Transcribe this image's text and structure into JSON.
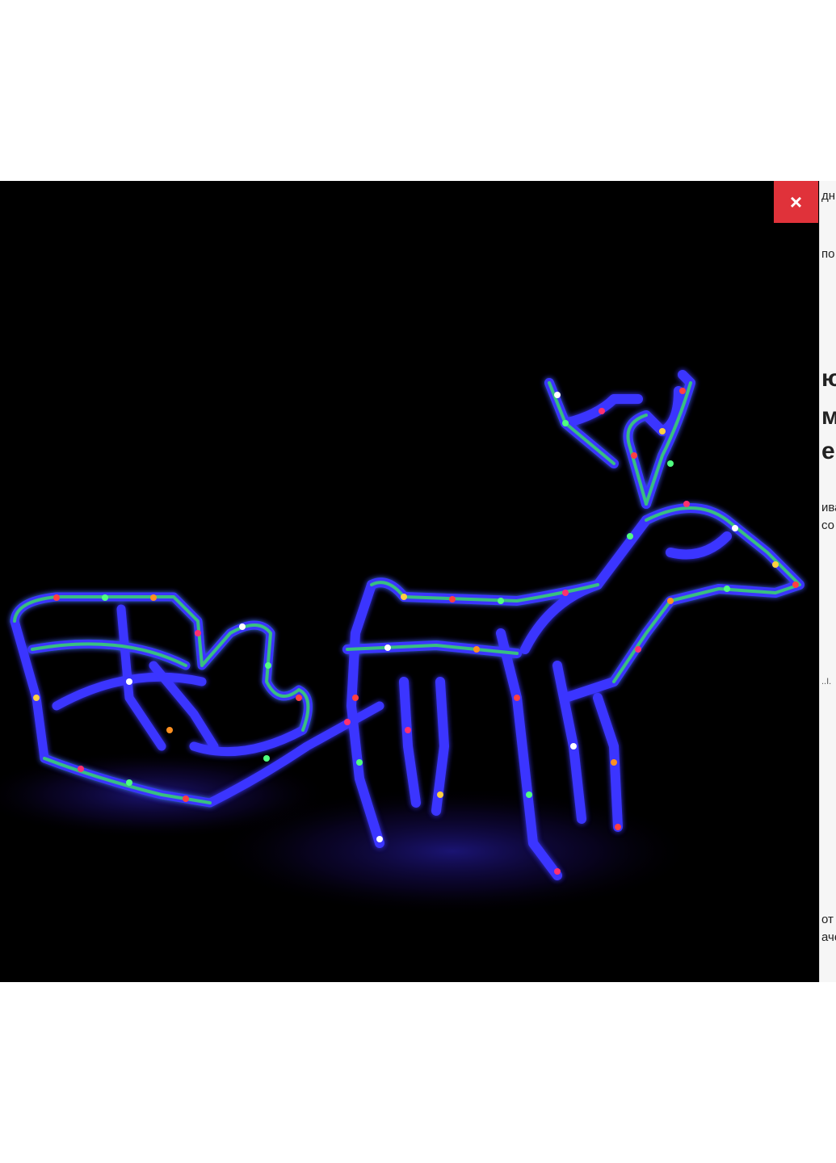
{
  "viewer": {
    "close_icon": "close-icon",
    "close_glyph": "×",
    "close_color": "#e0323a",
    "photo_subject": "LED reindeer with sleigh figure",
    "background_color": "#000000"
  },
  "underlay_text": {
    "line1": "дн",
    "line2": "по",
    "line3": "ю",
    "line4": "мі",
    "line5": "ек",
    "line6": "ива",
    "line7": "со",
    "line8": "..I.",
    "line9": "от р",
    "line10": "аче"
  }
}
